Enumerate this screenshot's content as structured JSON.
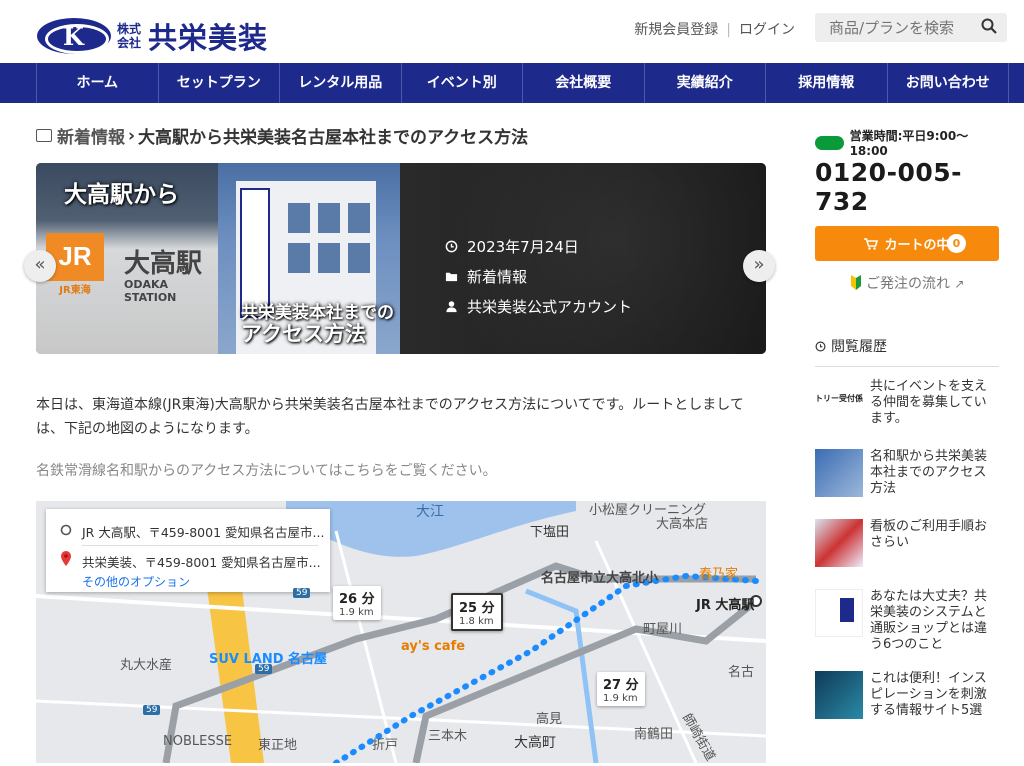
{
  "header": {
    "logo_mark": "K",
    "logo_kk": "株式会社",
    "logo_name": "共栄美装",
    "links": [
      "新規会員登録",
      "ログイン"
    ],
    "search_placeholder": "商品/プランを検索"
  },
  "nav": [
    "ホーム",
    "セットプラン",
    "レンタル用品",
    "イベント別",
    "会社概要",
    "実績紹介",
    "採用情報",
    "お問い合わせ"
  ],
  "breadcrumb": {
    "category": "新着情報",
    "separator": "›",
    "title": "大高駅から共栄美装名古屋本社までのアクセス方法"
  },
  "hero": {
    "caption_top": "大高駅から",
    "caption_jr": "JR",
    "caption_jr_sub": "JR東海",
    "caption_station": "大高駅",
    "caption_station_en": "ODAKA STATION",
    "caption_bottom_1": "共栄美装本社までの",
    "caption_bottom_2": "アクセス方法",
    "date": "2023年7月24日",
    "category": "新着情報",
    "author": "共栄美装公式アカウント",
    "prev": "«",
    "next": "»"
  },
  "content": {
    "paragraph": "本日は、東海道本線(JR東海)大高駅から共栄美装名古屋本社までのアクセス方法についてです。ルートとしましては、下記の地図のようになります。",
    "link_text": "名鉄常滑線名和駅からのアクセス方法についてはこちらをご覧ください。"
  },
  "map": {
    "from": "JR 大高駅、〒459-8001 愛知県名古屋市...",
    "to": "共栄美装、〒459-8001 愛知県名古屋市...",
    "options": "その他のオプション",
    "routes": [
      {
        "time": "26 分",
        "dist": "1.9 km"
      },
      {
        "time": "25 分",
        "dist": "1.8 km"
      },
      {
        "time": "27 分",
        "dist": "1.9 km"
      }
    ],
    "labels": [
      "小松屋クリーニング",
      "大高本店",
      "下塩田",
      "名古屋市立大高北小",
      "春乃家",
      "JR 大高駅",
      "町屋川",
      "丸大水産",
      "SUV LAND 名古屋",
      "ay's cafe",
      "名古",
      "NOBLESSE",
      "東正地",
      "折戸",
      "三本木",
      "高見",
      "大高町",
      "南鶴田",
      "師崎街道",
      "59",
      "59",
      "59",
      "大江"
    ]
  },
  "sidebar": {
    "hours": "営業時間:平日9:00〜18:00",
    "tel": "0120-005-732",
    "cart_label": "カートの中",
    "cart_count": "0",
    "flow_link": "ご発注の流れ",
    "history_title": "閲覧履歴",
    "history": [
      {
        "title": "共にイベントを支える仲間を募集しています。",
        "thumb_text": "トリー受付係"
      },
      {
        "title": "名和駅から共栄美装本社までのアクセス方法",
        "thumb_text": ""
      },
      {
        "title": "看板のご利用手順おさらい",
        "thumb_text": ""
      },
      {
        "title": "あなたは大丈夫？共栄美装のシステムと通販ショップとは違う6つのこと",
        "thumb_text": ""
      },
      {
        "title": "これは便利！インスピレーションを刺激する情報サイト5選",
        "thumb_text": ""
      }
    ]
  },
  "colors": {
    "brand": "#1d2a8c",
    "accent": "#f7890c",
    "route": "#1a8cff"
  }
}
